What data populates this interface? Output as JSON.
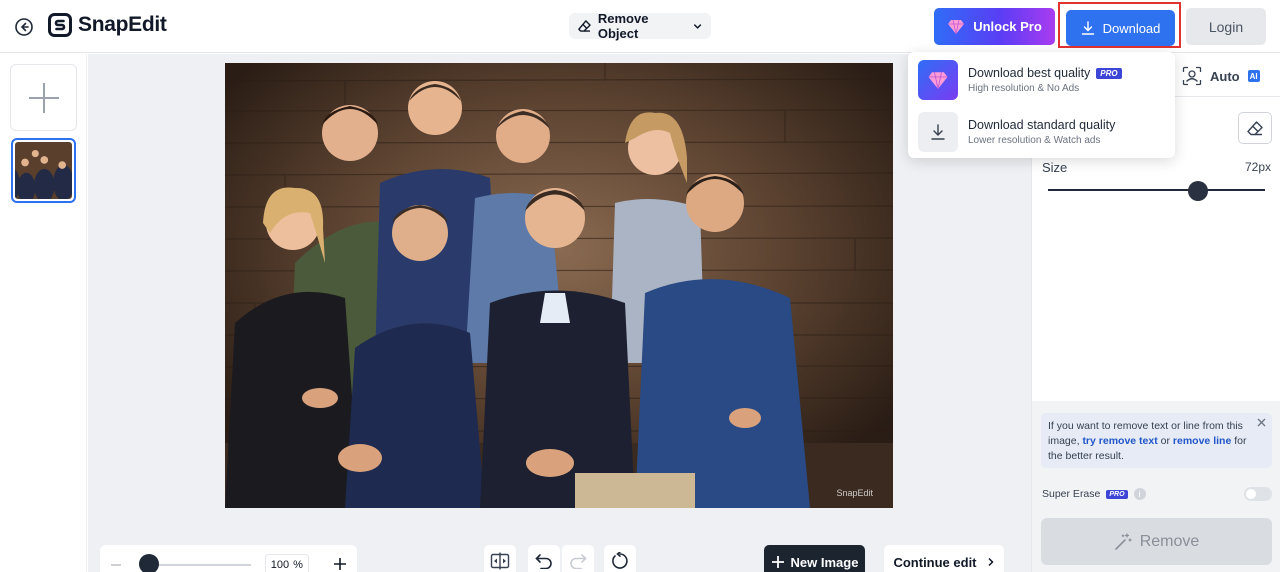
{
  "app": {
    "name": "SnapEdit"
  },
  "toolbar": {
    "tool_label": "Remove Object",
    "unlock_label": "Unlock Pro",
    "download_label": "Download",
    "login_label": "Login"
  },
  "download_menu": {
    "best": {
      "title": "Download best quality",
      "badge": "PRO",
      "subtitle": "High resolution & No Ads"
    },
    "standard": {
      "title": "Download standard quality",
      "subtitle": "Lower resolution & Watch ads"
    }
  },
  "canvas": {
    "watermark": "SnapEdit",
    "zoom_value": "100",
    "zoom_unit": "%",
    "new_image_label": "New Image",
    "continue_label": "Continue edit"
  },
  "panel": {
    "auto_label": "Auto",
    "ai_badge": "AI",
    "size_label": "Size",
    "size_value": "72px",
    "size_level_percent": 70,
    "tip": {
      "prefix": "If you want to remove text or line from this image,",
      "link1": "try remove text",
      "middle": "or",
      "link2": "remove line",
      "suffix": "for the better result."
    },
    "super_erase_label": "Super Erase",
    "super_erase_badge": "PRO",
    "super_erase_on": false,
    "remove_label": "Remove"
  },
  "icons": {
    "back": "back-arrow-icon",
    "tool": "eraser-icon",
    "unlock": "diamond-icon",
    "download": "download-icon",
    "auto": "face-scan-icon",
    "compare": "compare-icon",
    "undo": "undo-icon",
    "redo": "redo-icon",
    "reset": "reset-icon"
  },
  "colors": {
    "primary": "#2f72f0",
    "highlight_border": "#e0322f",
    "dark_button": "#1c2430",
    "pro_badge": "#3d45d6"
  }
}
